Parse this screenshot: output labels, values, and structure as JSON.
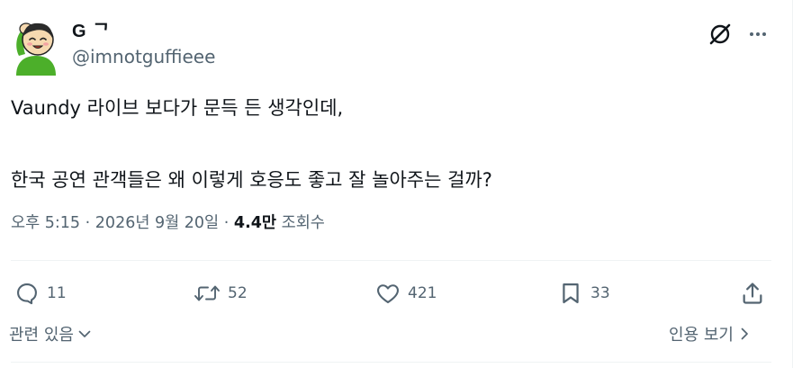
{
  "user": {
    "display_name": "G ᄀ",
    "handle": "@imnotguffieee"
  },
  "tweet": {
    "lines": [
      "Vaundy 라이브 보다가 문득 든 생각인데,",
      "한국 공연 관객들은 왜 이렇게 호응도 좋고 잘 놀아주는 걸까?"
    ],
    "time": "오후 5:15",
    "separator": "·",
    "date": "2026년 9월 20일",
    "views_count": "4.4만",
    "views_label": "조회수"
  },
  "actions": {
    "reply_count": "11",
    "retweet_count": "52",
    "like_count": "421",
    "bookmark_count": "33"
  },
  "footer": {
    "related_label": "관련 있음",
    "quotes_label": "인용 보기"
  },
  "icons": {
    "grok": "grok-icon",
    "more": "more-icon",
    "reply": "reply-icon",
    "retweet": "retweet-icon",
    "like": "heart-icon",
    "bookmark": "bookmark-icon",
    "share": "share-icon"
  },
  "colors": {
    "text_primary": "#0f1419",
    "text_secondary": "#536471",
    "divider": "#eff3f4",
    "avatar_green": "#4caf2a",
    "avatar_skin": "#f6d9b0"
  }
}
